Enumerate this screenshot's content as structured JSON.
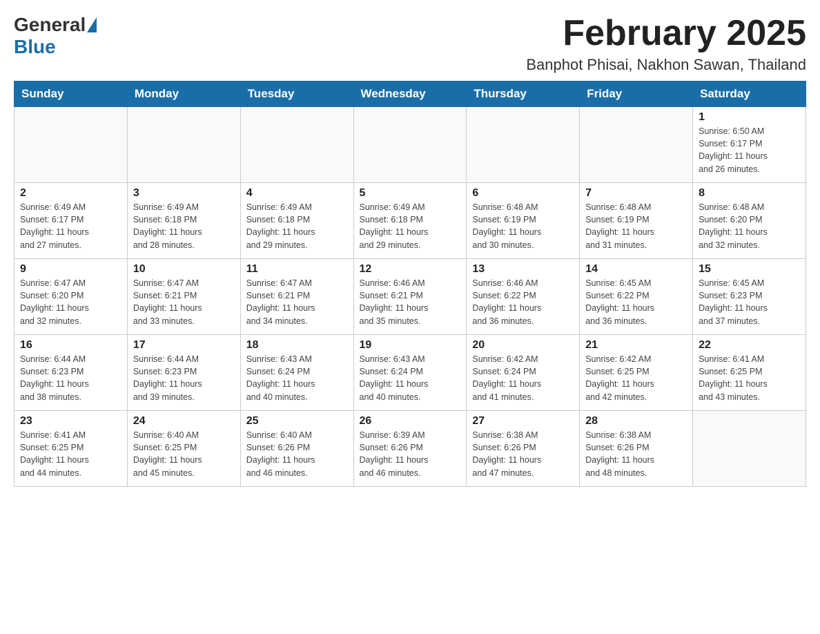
{
  "header": {
    "logo_general": "General",
    "logo_blue": "Blue",
    "month_title": "February 2025",
    "location": "Banphot Phisai, Nakhon Sawan, Thailand"
  },
  "days_of_week": [
    "Sunday",
    "Monday",
    "Tuesday",
    "Wednesday",
    "Thursday",
    "Friday",
    "Saturday"
  ],
  "weeks": [
    [
      {
        "day": "",
        "info": ""
      },
      {
        "day": "",
        "info": ""
      },
      {
        "day": "",
        "info": ""
      },
      {
        "day": "",
        "info": ""
      },
      {
        "day": "",
        "info": ""
      },
      {
        "day": "",
        "info": ""
      },
      {
        "day": "1",
        "info": "Sunrise: 6:50 AM\nSunset: 6:17 PM\nDaylight: 11 hours\nand 26 minutes."
      }
    ],
    [
      {
        "day": "2",
        "info": "Sunrise: 6:49 AM\nSunset: 6:17 PM\nDaylight: 11 hours\nand 27 minutes."
      },
      {
        "day": "3",
        "info": "Sunrise: 6:49 AM\nSunset: 6:18 PM\nDaylight: 11 hours\nand 28 minutes."
      },
      {
        "day": "4",
        "info": "Sunrise: 6:49 AM\nSunset: 6:18 PM\nDaylight: 11 hours\nand 29 minutes."
      },
      {
        "day": "5",
        "info": "Sunrise: 6:49 AM\nSunset: 6:18 PM\nDaylight: 11 hours\nand 29 minutes."
      },
      {
        "day": "6",
        "info": "Sunrise: 6:48 AM\nSunset: 6:19 PM\nDaylight: 11 hours\nand 30 minutes."
      },
      {
        "day": "7",
        "info": "Sunrise: 6:48 AM\nSunset: 6:19 PM\nDaylight: 11 hours\nand 31 minutes."
      },
      {
        "day": "8",
        "info": "Sunrise: 6:48 AM\nSunset: 6:20 PM\nDaylight: 11 hours\nand 32 minutes."
      }
    ],
    [
      {
        "day": "9",
        "info": "Sunrise: 6:47 AM\nSunset: 6:20 PM\nDaylight: 11 hours\nand 32 minutes."
      },
      {
        "day": "10",
        "info": "Sunrise: 6:47 AM\nSunset: 6:21 PM\nDaylight: 11 hours\nand 33 minutes."
      },
      {
        "day": "11",
        "info": "Sunrise: 6:47 AM\nSunset: 6:21 PM\nDaylight: 11 hours\nand 34 minutes."
      },
      {
        "day": "12",
        "info": "Sunrise: 6:46 AM\nSunset: 6:21 PM\nDaylight: 11 hours\nand 35 minutes."
      },
      {
        "day": "13",
        "info": "Sunrise: 6:46 AM\nSunset: 6:22 PM\nDaylight: 11 hours\nand 36 minutes."
      },
      {
        "day": "14",
        "info": "Sunrise: 6:45 AM\nSunset: 6:22 PM\nDaylight: 11 hours\nand 36 minutes."
      },
      {
        "day": "15",
        "info": "Sunrise: 6:45 AM\nSunset: 6:23 PM\nDaylight: 11 hours\nand 37 minutes."
      }
    ],
    [
      {
        "day": "16",
        "info": "Sunrise: 6:44 AM\nSunset: 6:23 PM\nDaylight: 11 hours\nand 38 minutes."
      },
      {
        "day": "17",
        "info": "Sunrise: 6:44 AM\nSunset: 6:23 PM\nDaylight: 11 hours\nand 39 minutes."
      },
      {
        "day": "18",
        "info": "Sunrise: 6:43 AM\nSunset: 6:24 PM\nDaylight: 11 hours\nand 40 minutes."
      },
      {
        "day": "19",
        "info": "Sunrise: 6:43 AM\nSunset: 6:24 PM\nDaylight: 11 hours\nand 40 minutes."
      },
      {
        "day": "20",
        "info": "Sunrise: 6:42 AM\nSunset: 6:24 PM\nDaylight: 11 hours\nand 41 minutes."
      },
      {
        "day": "21",
        "info": "Sunrise: 6:42 AM\nSunset: 6:25 PM\nDaylight: 11 hours\nand 42 minutes."
      },
      {
        "day": "22",
        "info": "Sunrise: 6:41 AM\nSunset: 6:25 PM\nDaylight: 11 hours\nand 43 minutes."
      }
    ],
    [
      {
        "day": "23",
        "info": "Sunrise: 6:41 AM\nSunset: 6:25 PM\nDaylight: 11 hours\nand 44 minutes."
      },
      {
        "day": "24",
        "info": "Sunrise: 6:40 AM\nSunset: 6:25 PM\nDaylight: 11 hours\nand 45 minutes."
      },
      {
        "day": "25",
        "info": "Sunrise: 6:40 AM\nSunset: 6:26 PM\nDaylight: 11 hours\nand 46 minutes."
      },
      {
        "day": "26",
        "info": "Sunrise: 6:39 AM\nSunset: 6:26 PM\nDaylight: 11 hours\nand 46 minutes."
      },
      {
        "day": "27",
        "info": "Sunrise: 6:38 AM\nSunset: 6:26 PM\nDaylight: 11 hours\nand 47 minutes."
      },
      {
        "day": "28",
        "info": "Sunrise: 6:38 AM\nSunset: 6:26 PM\nDaylight: 11 hours\nand 48 minutes."
      },
      {
        "day": "",
        "info": ""
      }
    ]
  ]
}
